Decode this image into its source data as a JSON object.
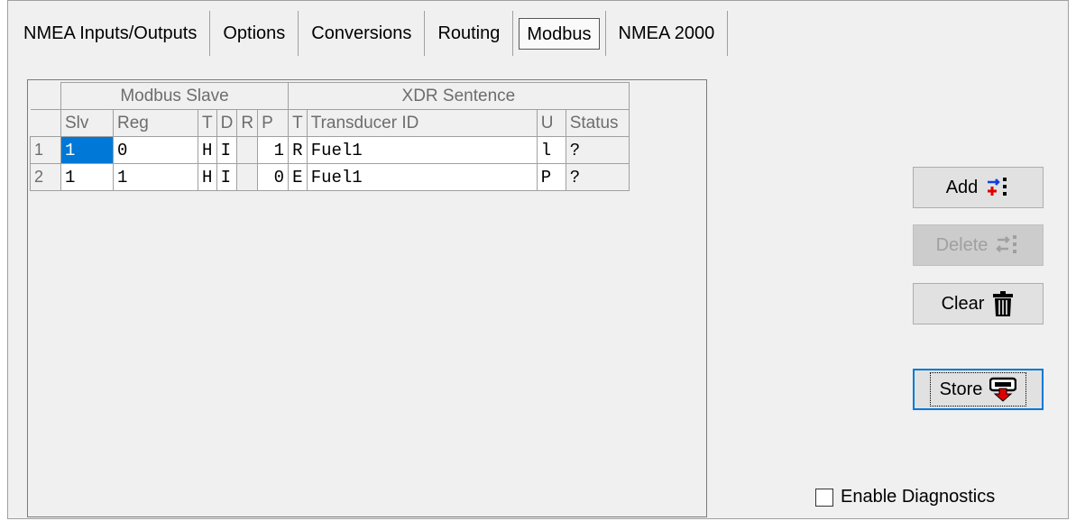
{
  "tabs": [
    {
      "label": "NMEA Inputs/Outputs"
    },
    {
      "label": "Options"
    },
    {
      "label": "Conversions"
    },
    {
      "label": "Routing"
    },
    {
      "label": "Modbus",
      "selected": true
    },
    {
      "label": "NMEA 2000"
    }
  ],
  "grid": {
    "groups": {
      "modbus_slave": "Modbus Slave",
      "xdr_sentence": "XDR Sentence"
    },
    "columns": [
      "Slv",
      "Reg",
      "T",
      "D",
      "R",
      "P",
      "T",
      "Transducer ID",
      "U",
      "Status"
    ],
    "rows": [
      {
        "num": "1",
        "slv": "1",
        "reg": "0",
        "t": "H",
        "d": "I",
        "r": "",
        "p": "1",
        "xt": "R",
        "id": "Fuel1",
        "u": "l",
        "status": "?"
      },
      {
        "num": "2",
        "slv": "1",
        "reg": "1",
        "t": "H",
        "d": "I",
        "r": "",
        "p": "0",
        "xt": "E",
        "id": "Fuel1",
        "u": "P",
        "status": "?"
      }
    ]
  },
  "buttons": {
    "add": "Add",
    "delete": "Delete",
    "clear": "Clear",
    "store": "Store"
  },
  "diagnostics": {
    "label": "Enable Diagnostics",
    "checked": false
  },
  "colors": {
    "selection": "#0078d7",
    "focus": "#0078d7",
    "icon_red": "#e00000",
    "icon_blue": "#1040e0"
  }
}
